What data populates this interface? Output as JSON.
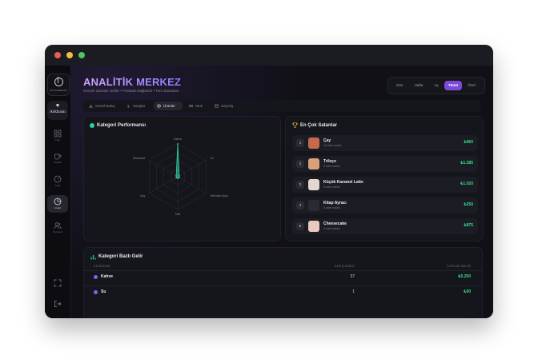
{
  "sidebar": {
    "logo_text": "ÜN PUBAHAS",
    "brand_text": "Arkham",
    "nav": [
      {
        "label": "Kafe",
        "icon": "grid-icon"
      },
      {
        "label": "Mutfak",
        "icon": "cup-icon"
      },
      {
        "label": "Kasa",
        "icon": "gauge-icon"
      },
      {
        "label": "Analiz",
        "icon": "pie-chart-icon"
      },
      {
        "label": "Personel",
        "icon": "users-icon"
      }
    ],
    "bottom_icons": [
      "fullscreen-icon",
      "logout-icon"
    ]
  },
  "header": {
    "title": "ANALİTİK MERKEZ",
    "subtitle": "Gerçek zamanlı veriler • Firebase bağlantılı • Tüm Zamanlar"
  },
  "range": {
    "options": [
      "Gün",
      "Hafta",
      "Ay",
      "Tümü",
      "Özel"
    ],
    "active": "Tümü"
  },
  "tabs": [
    {
      "label": "Genel Bakış",
      "icon": "chart-icon"
    },
    {
      "label": "Satışlar",
      "icon": "dollar-icon"
    },
    {
      "label": "Ürünler",
      "icon": "box-icon"
    },
    {
      "label": "Stok",
      "icon": "stock-icon"
    },
    {
      "label": "Geçmiş",
      "icon": "calendar-icon"
    }
  ],
  "performance": {
    "title": "Kategori Performansı",
    "icon": "category-dot-icon"
  },
  "chart_data": {
    "type": "radar",
    "categories": [
      "Kahve",
      "Su",
      "Herbatik Ayçe",
      "Tatlı",
      "Çay",
      "Meşrubat"
    ],
    "values": [
      37,
      1,
      2,
      1,
      2,
      1
    ],
    "range": [
      0,
      37
    ]
  },
  "top_sellers": {
    "title": "En Çok Satanlar",
    "icon": "trophy-icon",
    "items": [
      {
        "rank": "1",
        "name": "Çay",
        "sub": "14 adet satıldı",
        "price": "₺960",
        "color": "#c66a4e"
      },
      {
        "rank": "2",
        "name": "Trileçe",
        "sub": "9 adet satıldı",
        "price": "₺1.385",
        "color": "#d9a07a"
      },
      {
        "rank": "3",
        "name": "Küçük Karamel Latte",
        "sub": "8 adet satıldı",
        "price": "₺1.020",
        "color": "#e4d7cf"
      },
      {
        "rank": "4",
        "name": "Kitap Ayracı",
        "sub": "5 adet satıldı",
        "price": "₺250",
        "color": "#2a2a33"
      },
      {
        "rank": "5",
        "name": "Cheesecake",
        "sub": "5 adet satıldı",
        "price": "₺875",
        "color": "#e9c9c0"
      }
    ]
  },
  "income": {
    "title": "Kategori Bazlı Gelir",
    "icon": "bar-icon",
    "headers": {
      "category": "KATEGORİ",
      "count": "SATIŞ ADEDİ",
      "income": "TOPLAM GELİR"
    },
    "rows": [
      {
        "name": "Kahve",
        "count": "37",
        "income": "₺5.250"
      },
      {
        "name": "Su",
        "count": "1",
        "income": "₺30"
      }
    ]
  }
}
